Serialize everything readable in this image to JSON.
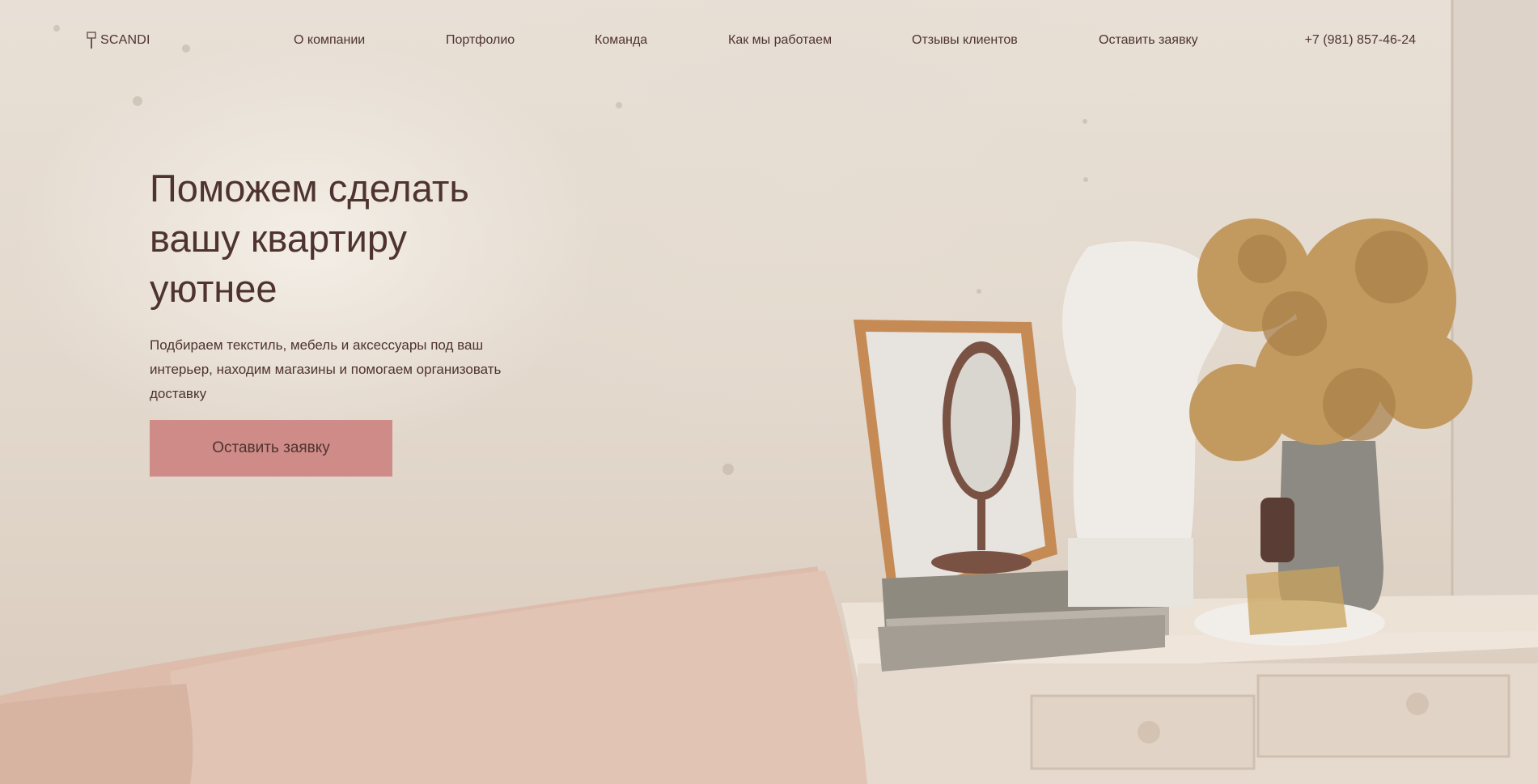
{
  "brand": {
    "name": "SCANDI"
  },
  "nav": [
    {
      "label": "О компании"
    },
    {
      "label": "Портфолио"
    },
    {
      "label": "Команда"
    },
    {
      "label": "Как мы работаем"
    },
    {
      "label": "Отзывы клиентов"
    },
    {
      "label": "Оставить заявку"
    }
  ],
  "phone": "+7 (981) 857-46-24",
  "hero": {
    "title_line1": "Поможем сделать",
    "title_line2": "вашу квартиру",
    "title_line3": "уютнее",
    "subtitle": "Подбираем текстиль, мебель и аксессуары под ваш интерьер, находим магазины и помогаем организовать доставку",
    "cta_label": "Оставить заявку"
  },
  "colors": {
    "text": "#4e3330",
    "accent": "#cf8b87",
    "background": "#e7ddd2"
  },
  "icons": [
    "brush-logo-icon"
  ]
}
